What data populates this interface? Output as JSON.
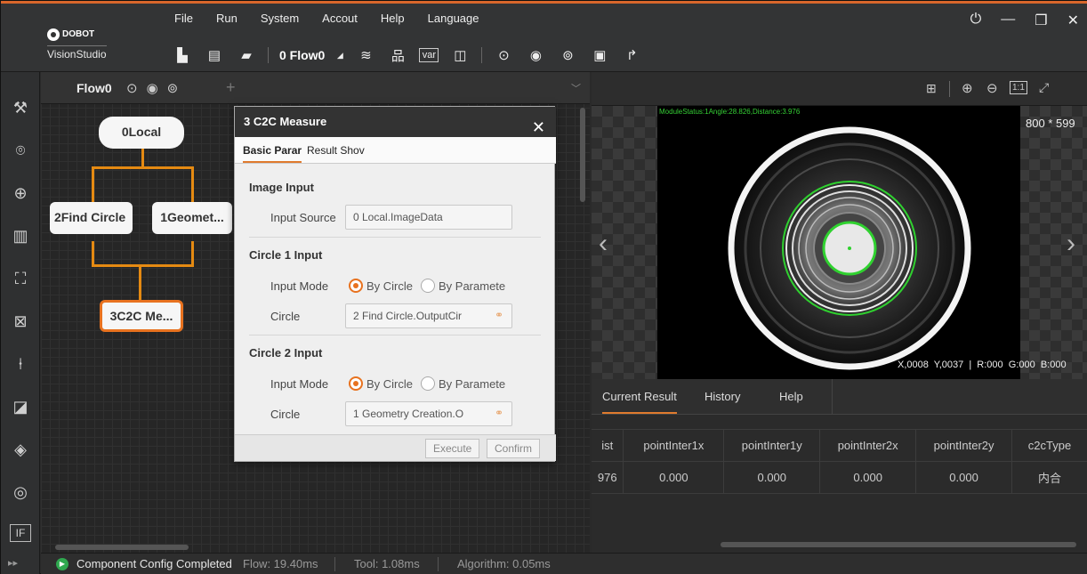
{
  "app": {
    "brand": "DOBOT",
    "name": "VisionStudio"
  },
  "menu": [
    "File",
    "Run",
    "System",
    "Accout",
    "Help",
    "Language"
  ],
  "toolbar": {
    "flow_selector": "0 Flow0",
    "var_label": "var"
  },
  "flow": {
    "tab_label": "Flow0",
    "nodes": {
      "local": "0Local",
      "find_circle": "2Find Circle",
      "geometry": "1Geomet...",
      "c2c": "3C2C Me..."
    }
  },
  "dialog": {
    "title": "3 C2C Measure",
    "tabs": [
      "Basic Parar",
      "Result Shov"
    ],
    "image_input": {
      "section": "Image Input",
      "label": "Input Source",
      "value": "0 Local.ImageData"
    },
    "circle1": {
      "section": "Circle 1 Input",
      "mode_label": "Input Mode",
      "opt1": "By Circle",
      "opt2": "By Paramete",
      "circle_label": "Circle",
      "circle_value": "2 Find Circle.OutputCir"
    },
    "circle2": {
      "section": "Circle 2 Input",
      "mode_label": "Input Mode",
      "opt1": "By Circle",
      "opt2": "By Paramete",
      "circle_label": "Circle",
      "circle_value": "1 Geometry Creation.O"
    },
    "buttons": {
      "execute": "Execute",
      "confirm": "Confirm"
    }
  },
  "image": {
    "status_overlay": "ModuleStatus:1Angle:28.826,Distance:3.976",
    "size": "800 * 599",
    "pixel_info": "X,0008  Y,0037  |  R:000  G:000  B:000"
  },
  "results": {
    "tabs": [
      "Current Result",
      "History",
      "Help"
    ],
    "columns": [
      "ist",
      "pointInter1x",
      "pointInter1y",
      "pointInter2x",
      "pointInter2y",
      "c2cType"
    ],
    "row": [
      "976",
      "0.000",
      "0.000",
      "0.000",
      "0.000",
      "内合"
    ]
  },
  "status": {
    "message": "Component Config Completed",
    "flow": "Flow: 19.40ms",
    "tool": "Tool: 1.08ms",
    "algorithm": "Algorithm: 0.05ms"
  },
  "colors": {
    "accent": "#e07b2e",
    "wire": "#e58a12",
    "ring": "#2fd12f"
  }
}
